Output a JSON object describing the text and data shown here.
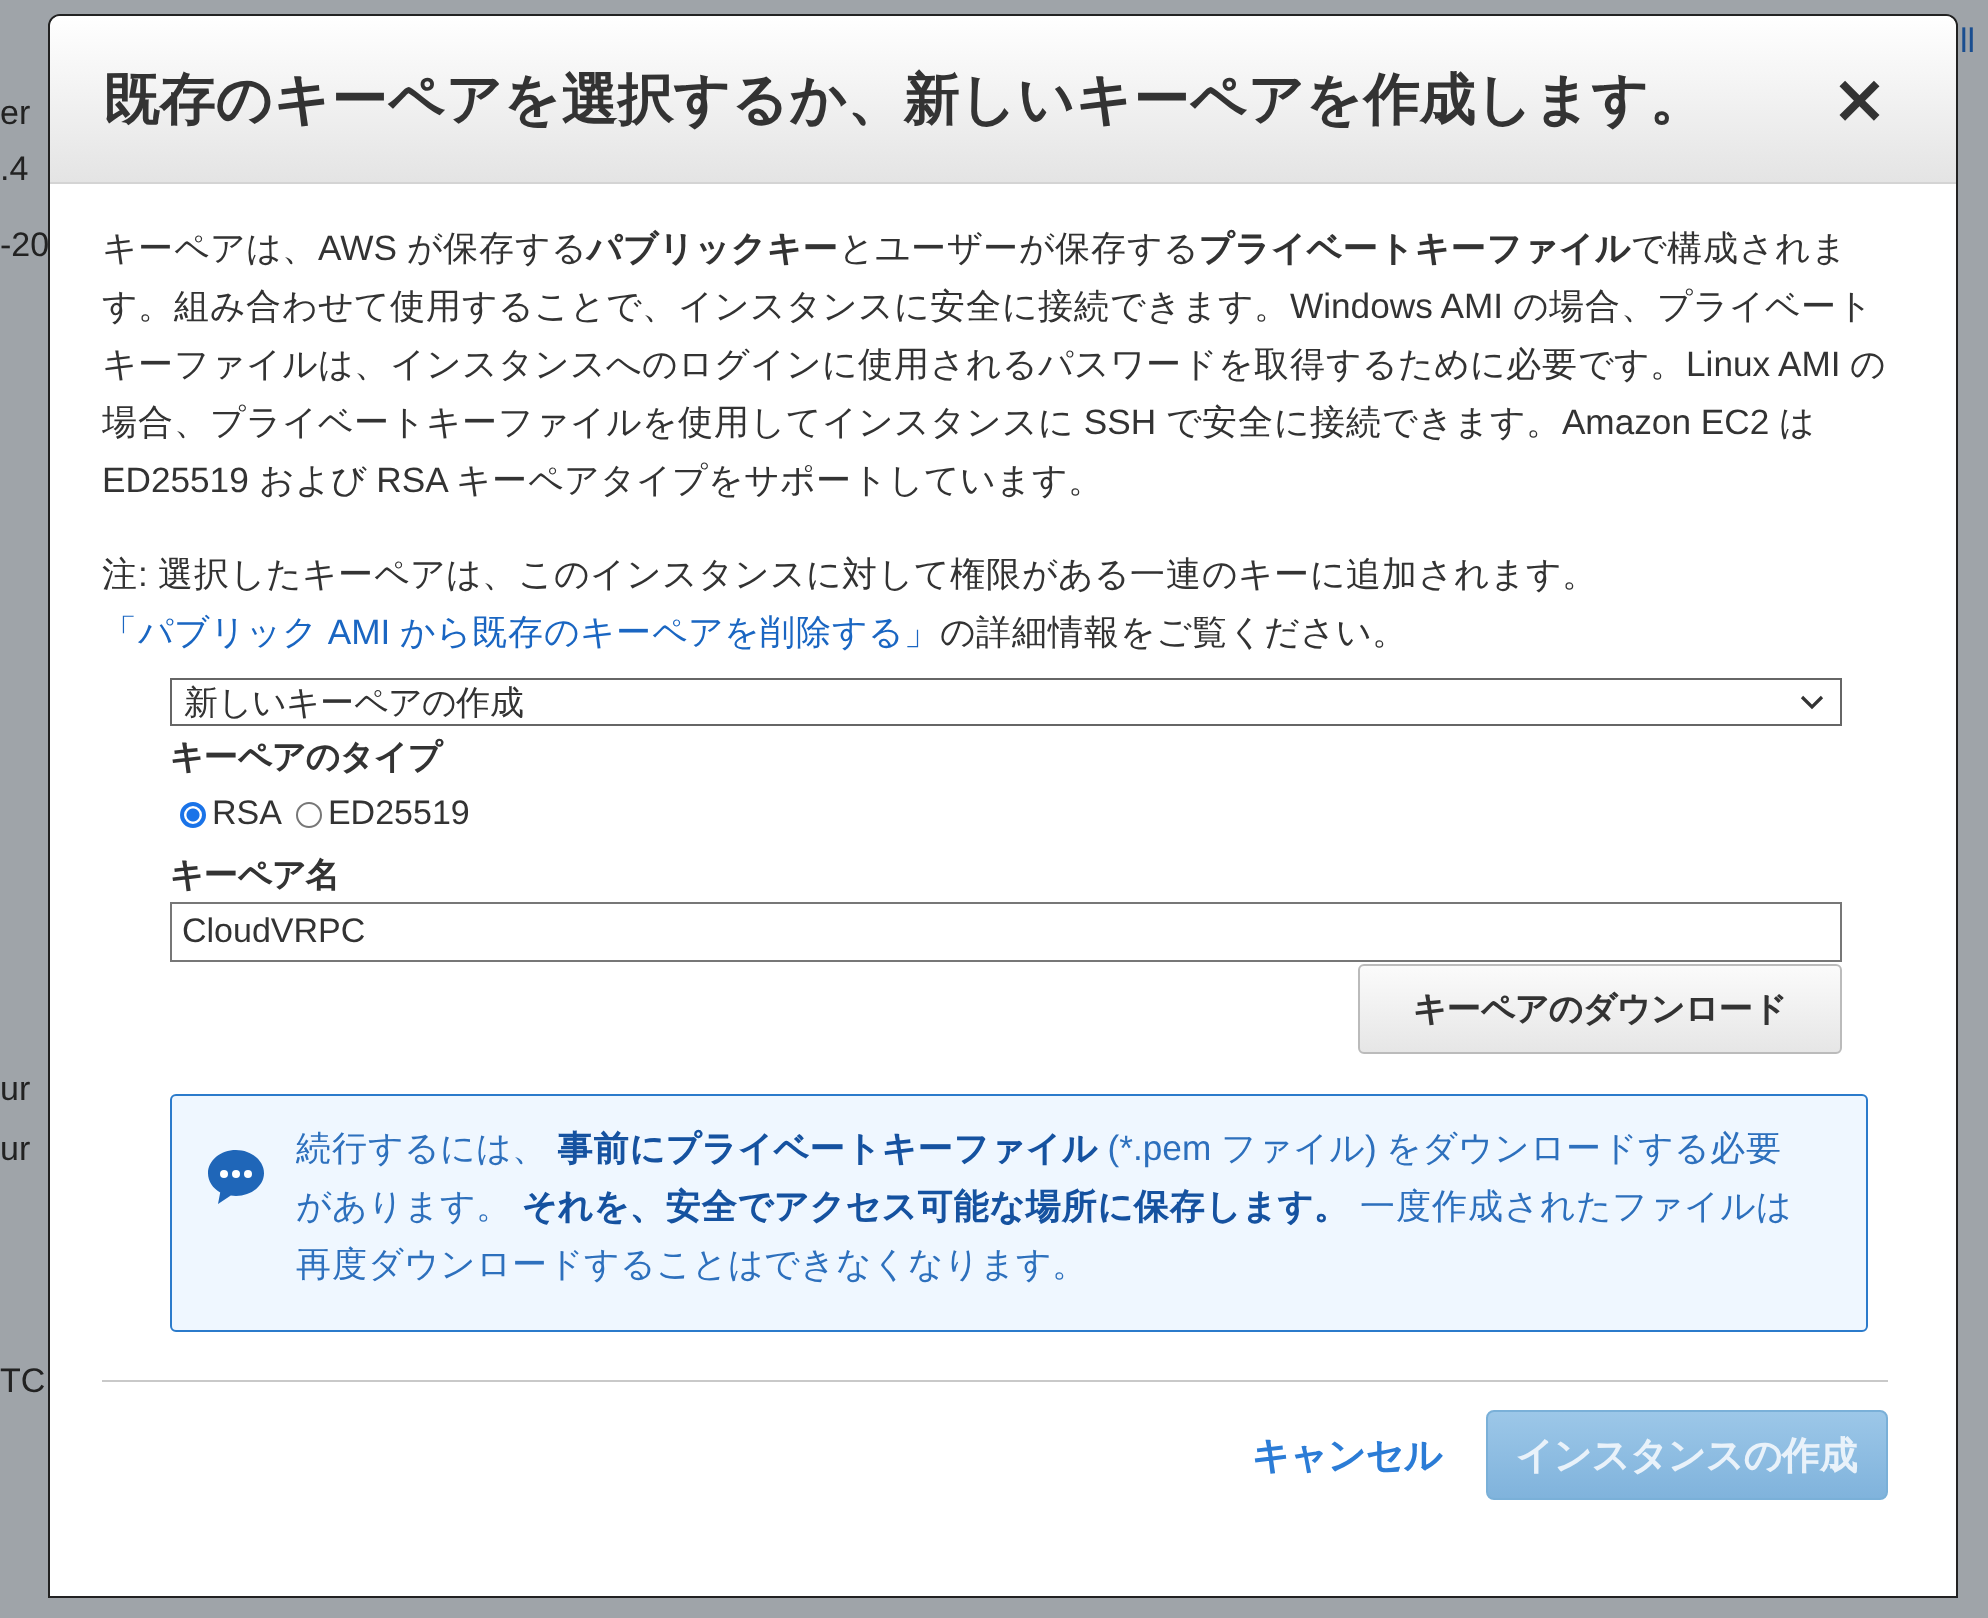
{
  "background": {
    "left_fragments": [
      "er",
      ".4",
      "-20",
      "ur",
      "ur",
      "TC"
    ],
    "right_fragments": [
      "ll"
    ]
  },
  "dialog": {
    "title": "既存のキーペアを選択するか、新しいキーペアを作成します。",
    "close": "×",
    "intro": "キーペアは、AWS が保存する**パブリックキー**とユーザーが保存する**プライベートキーファイル**で構成されます。組み合わせて使用することで、インスタンスに安全に接続できます。Windows AMI の場合、プライベートキーファイルは、インスタンスへのログインに使用されるパスワードを取得するために必要です。Linux AMI の場合、プライベートキーファイルを使用してインスタンスに SSH で安全に接続できます。Amazon EC2 は ED25519 および RSA キーペアタイプをサポートしています。",
    "note": {
      "before": "注: 選択したキーペアは、このインスタンスに対して権限がある一連のキーに追加されます。",
      "link": "「パブリック AMI から既存のキーペアを削除する」",
      "after": "の詳細情報をご覧ください。"
    },
    "key_pair_select": {
      "value": "新しいキーペアの作成"
    },
    "key_type": {
      "label": "キーペアのタイプ",
      "options": [
        {
          "label": "RSA",
          "selected": true
        },
        {
          "label": "ED25519",
          "selected": false
        }
      ]
    },
    "key_name": {
      "label": "キーペア名",
      "value": "CloudVRPC"
    },
    "download_button": "キーペアのダウンロード",
    "info": "続行するには、 **事前にプライベートキーファイル** (*.pem ファイル) をダウンロードする必要があります。 **それを、安全でアクセス可能な場所に保存します。** 一度作成されたファイルは再度ダウンロードすることはできなくなります。",
    "buttons": [
      {
        "label": "キャンセル",
        "kind": "link",
        "disabled": false
      },
      {
        "label": "インスタンスの作成",
        "kind": "primary",
        "disabled": true
      }
    ]
  }
}
